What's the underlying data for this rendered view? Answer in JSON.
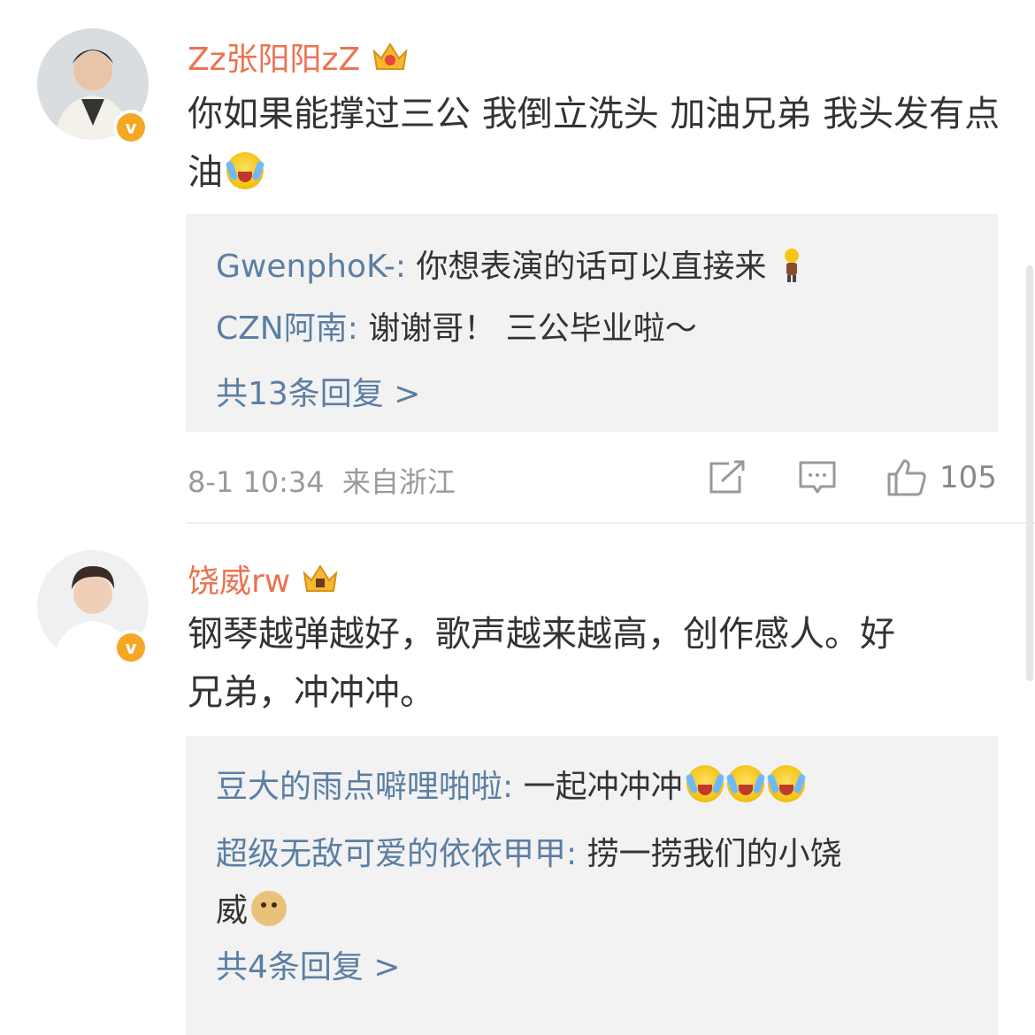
{
  "comments": [
    {
      "username": "Zz张阳阳zZ",
      "crown_icon": "crown-badge-icon",
      "verified_icon": "v",
      "text": "你如果能撑过三公 我倒立洗头 加油兄弟 我头发有点油",
      "replies": [
        {
          "user": "GwenphoK-:",
          "text": " 你想表演的话可以直接来"
        },
        {
          "user": "CZN阿南:",
          "text": " 谢谢哥！ 三公毕业啦～"
        }
      ],
      "more_replies": "共13条回复 >",
      "timestamp": "8-1 10:34",
      "location": "来自浙江",
      "likes": "105"
    },
    {
      "username": "饶威rw",
      "crown_icon": "crown-badge-icon",
      "verified_icon": "v",
      "text_line1": "钢琴越弹越好，歌声越来越高，创作感人。好",
      "text_line2": "兄弟，冲冲冲。",
      "replies": [
        {
          "user": "豆大的雨点噼哩啪啦:",
          "text": " 一起冲冲冲"
        },
        {
          "user": "超级无敌可爱的依依甲甲:",
          "text": " 捞一捞我们的小饶",
          "text_cont": "威"
        }
      ],
      "more_replies": "共4条回复 >"
    }
  ],
  "colors": {
    "username": "#eb7350",
    "reply_user": "#5b7ea4",
    "reply_bg": "#f2f2f2",
    "verified": "#f5a623"
  }
}
